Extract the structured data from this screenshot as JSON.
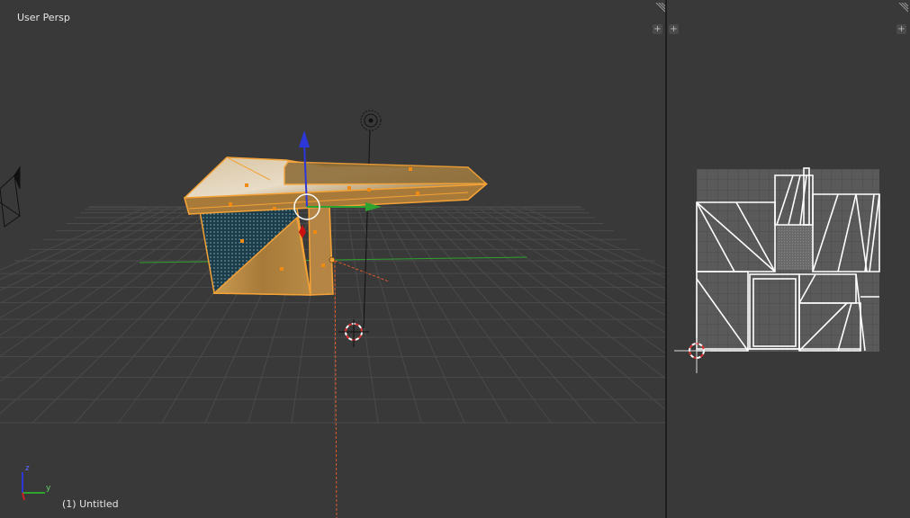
{
  "viewport": {
    "view_label": "User Persp",
    "object_label": "(1) Untitled",
    "axis_gizmo": {
      "z_label": "z",
      "y_label": "y"
    }
  },
  "corner_controls": {
    "split_symbol": "+"
  },
  "icons": {
    "lamp": "lamp-icon",
    "camera": "camera-icon",
    "cursor": "3d-cursor-icon",
    "transform": "transform-manipulator-icon",
    "uv_cursor": "2d-cursor-icon"
  },
  "colors": {
    "background": "#393939",
    "grid": "#4a4a4a",
    "selection": "#f4a236",
    "x_axis": "#cc2222",
    "y_axis": "#2fa32f",
    "z_axis": "#2d37d8",
    "uv_grid_bg": "#5a5a5a"
  }
}
